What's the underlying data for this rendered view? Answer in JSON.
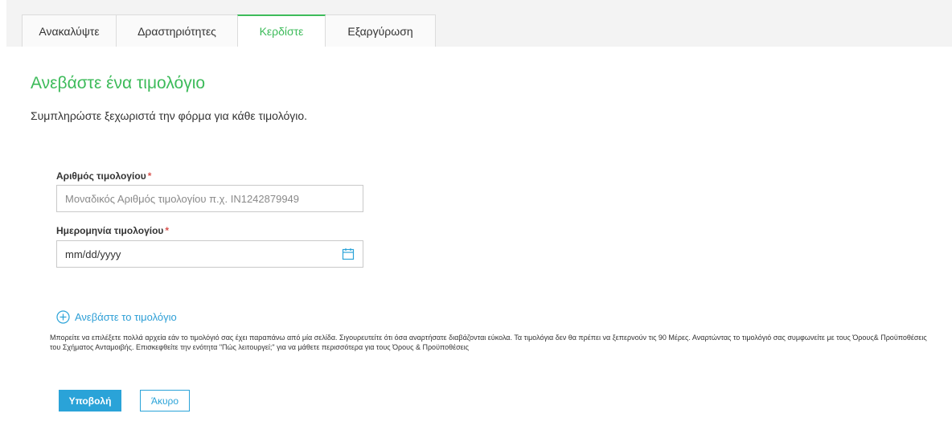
{
  "tabs": [
    {
      "label": "Ανακαλύψτε",
      "active": false
    },
    {
      "label": "Δραστηριότητες",
      "active": false
    },
    {
      "label": "Κερδίστε",
      "active": true
    },
    {
      "label": "Εξαργύρωση",
      "active": false
    }
  ],
  "form": {
    "title": "Ανεβάστε ένα τιμολόγιο",
    "subtitle": "Συμπληρώστε ξεχωριστά την φόρμα για κάθε τιμολόγιο.",
    "invoice_number": {
      "label": "Αριθμός τιμολογίου",
      "required_mark": "*",
      "value": "",
      "placeholder": "Μοναδικός Αριθμός τιμολογίου π.χ. IN1242879949"
    },
    "invoice_date": {
      "label": "Ημερομηνία τιμολογίου",
      "required_mark": "*",
      "value": "mm/dd/yyyy",
      "icon": "calendar-icon"
    },
    "upload": {
      "label": "Ανεβάστε το τιμολόγιο",
      "icon": "plus-circle-icon"
    },
    "note": "Μπορείτε να επιλέξετε πολλά αρχεία εάν το τιμολόγιό σας έχει παραπάνω από μία σελίδα. Σιγουρευτείτε ότι όσα αναρτήσατε διαβάζονται εύκολα. Τα τιμολόγια δεν θα πρέπει να ξεπερνούν τις 90 Μέρες. Αναρτώντας το τιμολόγιό σας συμφωνείτε με τους Όρους& Προϋποθέσεις του Σχήματος Ανταμοιβής. Επισκεφθείτε την ενότητα \"Πώς λειτουργεί;\" για να μάθετε περισσότερα για τους Όρους & Προϋποθέσεις",
    "submit_label": "Υποβολή",
    "cancel_label": "Άκυρο"
  },
  "colors": {
    "accent_green": "#3dbb5a",
    "accent_blue": "#2aa3d8",
    "required": "#d9534f"
  }
}
